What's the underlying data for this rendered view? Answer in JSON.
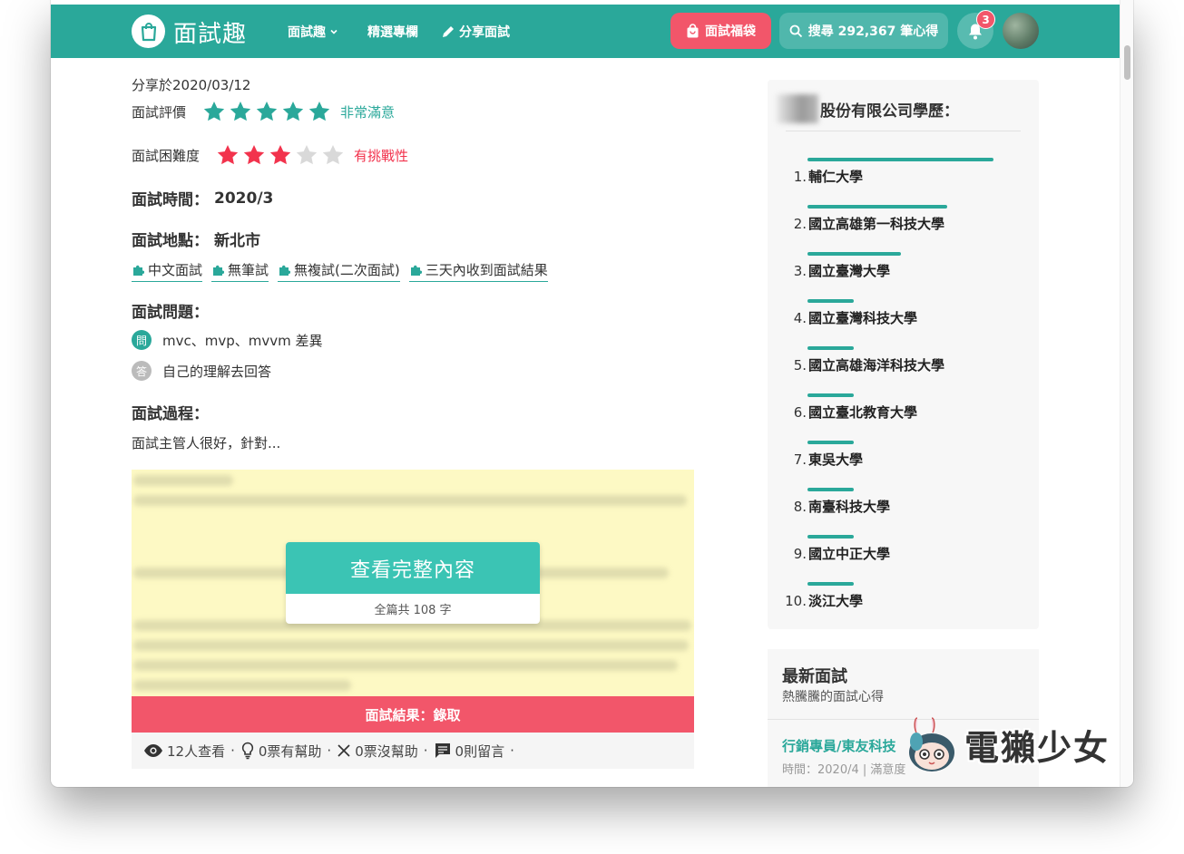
{
  "nav": {
    "logo_text": "面試趣",
    "links": [
      {
        "label": "面試趣"
      },
      {
        "label": "精選專欄"
      },
      {
        "label": "分享面試"
      }
    ],
    "bag_label": "面試福袋",
    "search_label": "搜尋 292,367 筆心得",
    "notification_count": "3",
    "colors": {
      "brand": "#2aa89a",
      "accent": "#f2566a"
    }
  },
  "post": {
    "shared_date": "分享於2020/03/12",
    "rating": {
      "label": "面試評價",
      "value": 5,
      "max": 5,
      "text": "非常滿意",
      "color": "#2aa89a"
    },
    "difficulty": {
      "label": "面試困難度",
      "value": 3,
      "max": 5,
      "text": "有挑戰性",
      "color": "#f2334d"
    },
    "time": {
      "label": "面試時間：",
      "value": "2020/3"
    },
    "location": {
      "label": "面試地點：",
      "value": "新北市"
    },
    "tags": [
      "中文面試",
      "無筆試",
      "無複試(二次面試)",
      "三天內收到面試結果"
    ],
    "questions_label": "面試問題：",
    "question_badge": "問",
    "question": "mvc、mvp、mvvm 差異",
    "answer_badge": "答",
    "answer": "自己的理解去回答",
    "process_label": "面試過程：",
    "process_preview": "面試主管人很好，針對...",
    "full_content_label": "查看完整內容",
    "word_count": "全篇共 108 字",
    "result": "面試結果：錄取",
    "stats": {
      "views": "12人查看",
      "helpful": "0票有幫助",
      "not_helpful": "0票沒幫助",
      "comments": "0則留言",
      "separator": "·"
    }
  },
  "sidebar": {
    "title": "股份有限公司學歷：",
    "schools": [
      {
        "rank": "1.",
        "name": "輔仁大學",
        "share": 1.0
      },
      {
        "rank": "2.",
        "name": "國立高雄第一科技大學",
        "share": 0.75
      },
      {
        "rank": "3.",
        "name": "國立臺灣大學",
        "share": 0.5
      },
      {
        "rank": "4.",
        "name": "國立臺灣科技大學",
        "share": 0.25
      },
      {
        "rank": "5.",
        "name": "國立高雄海洋科技大學",
        "share": 0.25
      },
      {
        "rank": "6.",
        "name": "國立臺北教育大學",
        "share": 0.25
      },
      {
        "rank": "7.",
        "name": "東吳大學",
        "share": 0.25
      },
      {
        "rank": "8.",
        "name": "南臺科技大學",
        "share": 0.25
      },
      {
        "rank": "9.",
        "name": "國立中正大學",
        "share": 0.25
      },
      {
        "rank": "10.",
        "name": "淡江大學",
        "share": 0.25
      }
    ],
    "latest_title": "最新面試",
    "latest_sub": "熱騰騰的面試心得",
    "latest_item_title": "行銷專員/東友科技",
    "latest_item_meta": "時間：2020/4 | 滿意度"
  },
  "watermark": {
    "text": "電獺少女"
  }
}
